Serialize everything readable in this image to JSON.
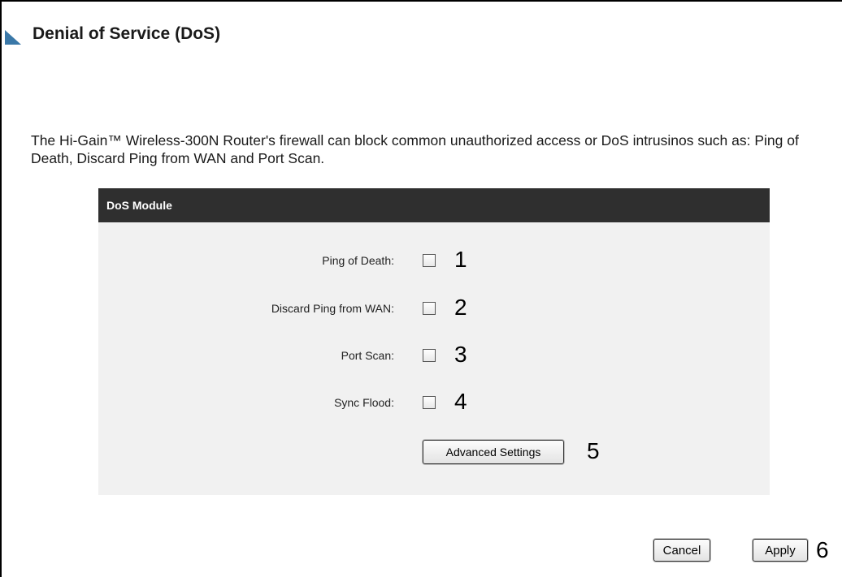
{
  "page": {
    "title": "Denial of Service (DoS)",
    "description": "The Hi-Gain™ Wireless-300N Router's firewall can block common unauthorized access or DoS intrusinos such as: Ping of Death, Discard Ping from WAN and Port Scan."
  },
  "dos_module": {
    "header": "DoS Module",
    "options": [
      {
        "label": "Ping of Death:",
        "checked": false,
        "marker": "1"
      },
      {
        "label": "Discard Ping from WAN:",
        "checked": false,
        "marker": "2"
      },
      {
        "label": "Port Scan:",
        "checked": false,
        "marker": "3"
      },
      {
        "label": "Sync Flood:",
        "checked": false,
        "marker": "4"
      }
    ],
    "advanced_button": "Advanced Settings",
    "advanced_marker": "5"
  },
  "actions": {
    "cancel": "Cancel",
    "apply": "Apply",
    "marker": "6"
  },
  "colors": {
    "header_bg": "#2f2f2f",
    "panel_bg": "#f1f1f1",
    "title_triangle": "#3a78a8"
  }
}
